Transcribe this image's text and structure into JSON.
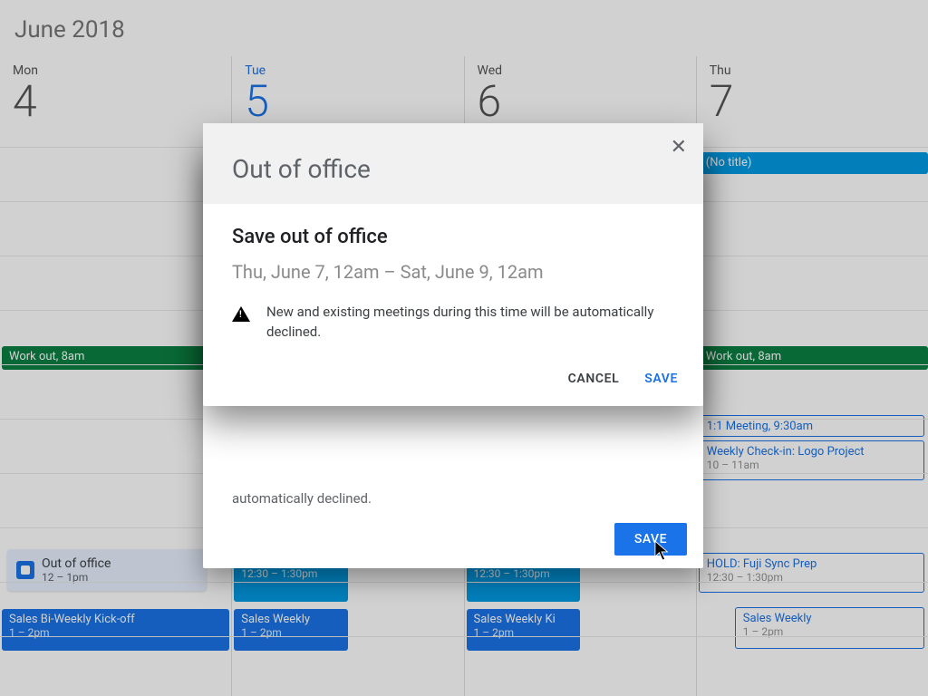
{
  "header": {
    "month": "June 2018"
  },
  "days": [
    {
      "abbr": "Mon",
      "num": "4",
      "today": false
    },
    {
      "abbr": "Tue",
      "num": "5",
      "today": true
    },
    {
      "abbr": "Wed",
      "num": "6",
      "today": false
    },
    {
      "abbr": "Thu",
      "num": "7",
      "today": false
    }
  ],
  "events": {
    "no_title": "(No title)",
    "workout": "Work out, 8am",
    "meeting_1_1": "1:1 Meeting, 9:30am",
    "weekly_checkin": {
      "title": "Weekly Check-in: Logo Project",
      "time": "10 – 11am"
    },
    "hold_fuji": {
      "title": "HOLD: Fuji Sync Prep",
      "time": "12:30 – 1:30pm"
    },
    "sales_weekly": {
      "title": "Sales Weekly",
      "time": "1 – 2pm"
    },
    "sales_weekly_kick": {
      "title": "Sales Weekly Ki",
      "time": "1 – 2pm"
    },
    "sales_biweekly": {
      "title": "Sales Bi-Weekly Kick-off",
      "time": "1 – 2pm"
    },
    "ooo_chip": {
      "title": "Out of office",
      "time": "12 – 1pm"
    }
  },
  "panel1": {
    "title": "Out of office",
    "body": "automatically declined.",
    "save": "SAVE"
  },
  "dialog": {
    "sup": "Out of office",
    "title": "Save out of office",
    "range": "Thu, June 7, 12am – Sat, June 9, 12am",
    "warn": "New and existing meetings during this time will be automatically declined.",
    "cancel": "CANCEL",
    "save": "SAVE"
  }
}
